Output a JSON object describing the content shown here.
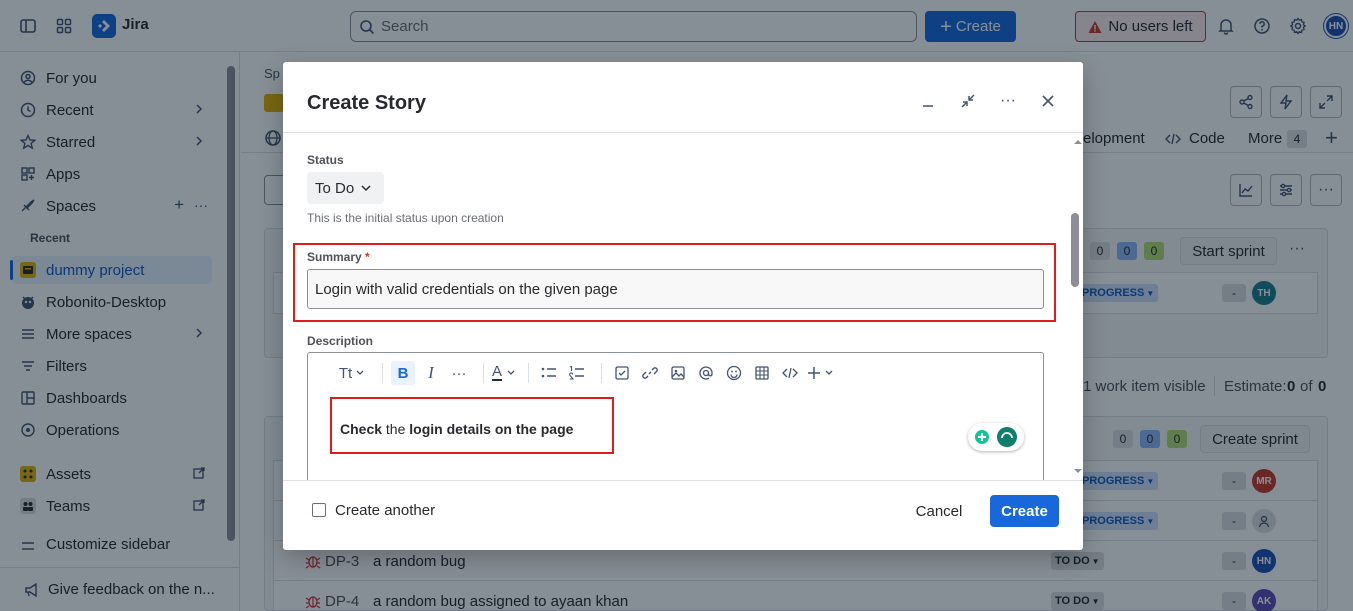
{
  "topbar": {
    "app_name": "Jira",
    "search_placeholder": "Search",
    "create_label": "Create",
    "no_users_label": "No users left",
    "avatar_initials": "HN"
  },
  "sidebar": {
    "items": [
      {
        "label": "For you"
      },
      {
        "label": "Recent"
      },
      {
        "label": "Starred"
      },
      {
        "label": "Apps"
      },
      {
        "label": "Spaces"
      }
    ],
    "recent_section": "Recent",
    "recent_items": [
      {
        "label": "dummy project"
      },
      {
        "label": "Robonito-Desktop"
      },
      {
        "label": "More spaces"
      }
    ],
    "lower_items": [
      {
        "label": "Filters"
      },
      {
        "label": "Dashboards"
      },
      {
        "label": "Operations"
      },
      {
        "label": "Assets"
      },
      {
        "label": "Teams"
      },
      {
        "label": "Customize sidebar"
      }
    ],
    "feedback_label": "Give feedback on the n..."
  },
  "main": {
    "breadcrumb_partial": "Sp",
    "tabs_visible": {
      "development": "elopment",
      "code": "Code",
      "more": "More",
      "more_count": "4"
    },
    "sprint1": {
      "counts": [
        "0",
        "0",
        "0"
      ],
      "start_sprint": "Start sprint",
      "summary": "1 work item visible",
      "estimate_label": "Estimate:",
      "estimate_value": "0",
      "estimate_of": "of",
      "estimate_total": "0"
    },
    "sprint2": {
      "counts": [
        "0",
        "0",
        "0"
      ],
      "create_sprint": "Create sprint"
    },
    "rows": [
      {
        "status": "PROGRESS",
        "assignee": "TH",
        "color": "#1D7F8C"
      },
      {
        "status": "PROGRESS",
        "assignee": "MR",
        "color": "#C9372C"
      },
      {
        "status": "PROGRESS",
        "assignee": "",
        "color": "#DDDEE1"
      },
      {
        "key": "DP-3",
        "title": "a random bug",
        "status": "TO DO",
        "assignee": "HN",
        "color": "#1D4FB5"
      },
      {
        "key": "DP-4",
        "title": "a random bug assigned to ayaan khan",
        "status": "TO DO",
        "assignee": "AK",
        "color": "#5E4DB2"
      }
    ],
    "dash": "-"
  },
  "modal": {
    "title": "Create Story",
    "status_label": "Status",
    "status_value": "To Do",
    "status_helper": "This is the initial status upon creation",
    "summary_label": "Summary",
    "summary_required": "*",
    "summary_value": "Login with valid credentials on the given page",
    "description_label": "Description",
    "toolbar": {
      "text_style": "Tt",
      "bold": "B",
      "italic": "I",
      "more": "···",
      "text_color": "A"
    },
    "description_parts": {
      "part1": "Check",
      "part2": " the ",
      "part3": "login details on the page"
    },
    "create_another_label": "Create another",
    "cancel_label": "Cancel",
    "create_label": "Create"
  },
  "colors": {
    "brand": "#1868DB",
    "highlight_box": "#E01D1D",
    "overlay": "rgba(5,21,36,0.48)"
  }
}
